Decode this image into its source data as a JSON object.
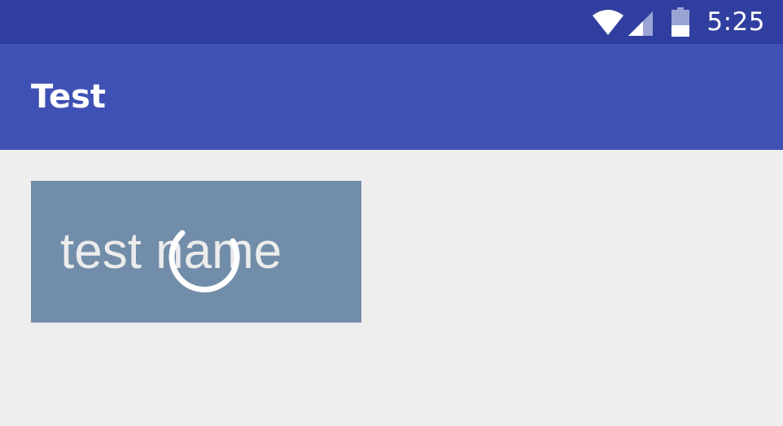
{
  "status_bar": {
    "time": "5:25",
    "icons": [
      "wifi-icon",
      "signal-icon",
      "battery-icon"
    ],
    "color": "#303f9f"
  },
  "app_bar": {
    "title": "Test",
    "color": "#3f51b5"
  },
  "main": {
    "background": "#eeeeee",
    "card": {
      "text": "test name",
      "background": "#728da9",
      "loading": true
    }
  }
}
